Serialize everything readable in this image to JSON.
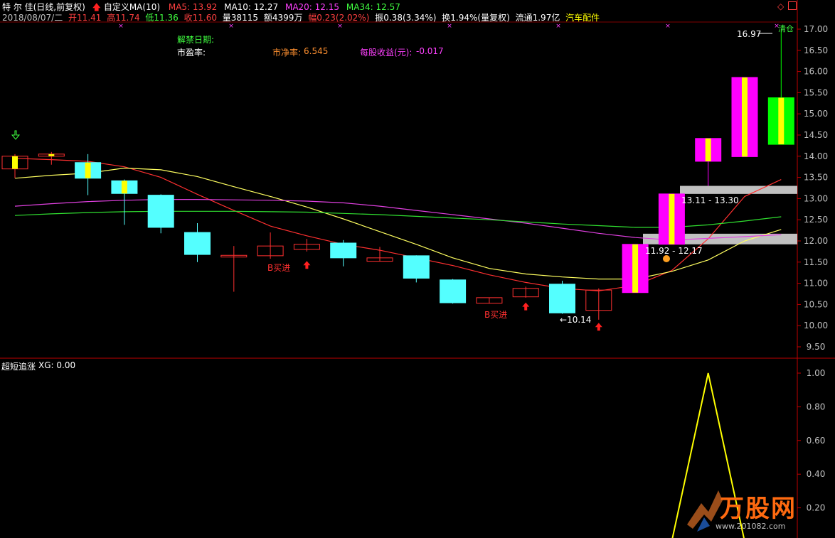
{
  "header": {
    "title": "特 尔 佳(日线,前复权)",
    "indicator": "自定义MA(10)",
    "ma": [
      {
        "label": "MA5: 13.92",
        "color": "#ff4040"
      },
      {
        "label": "MA10: 12.27",
        "color": "#ffff60"
      },
      {
        "label": "MA20: 12.15",
        "color": "#ff40ff"
      },
      {
        "label": "MA34: 12.57",
        "color": "#40ff40"
      }
    ],
    "info": [
      {
        "text": "2018/08/07/二",
        "color": "#c0c0c0"
      },
      {
        "text": "开11.41",
        "color": "#ff4040"
      },
      {
        "text": "高11.74",
        "color": "#ff4040"
      },
      {
        "text": "低11.36",
        "color": "#40ff40"
      },
      {
        "text": "收11.60",
        "color": "#ff4040"
      },
      {
        "text": "量38115",
        "color": "#ffffff"
      },
      {
        "text": "额4399万",
        "color": "#ffffff"
      },
      {
        "text": "幅0.23(2.02%)",
        "color": "#ff4040"
      },
      {
        "text": "振0.38(3.34%)",
        "color": "#ffffff"
      },
      {
        "text": "换1.94%(量复权)",
        "color": "#ffffff"
      },
      {
        "text": "流通1.97亿",
        "color": "#ffffff"
      },
      {
        "text": "汽车配件",
        "color": "#ffff00"
      }
    ]
  },
  "info_panel": {
    "unlock_label": "解禁日期:",
    "pe_label": "市盈率:",
    "pb_label": "市净率:",
    "pb_value": "6.545",
    "eps_label": "每股收益(元):",
    "eps_value": "-0.017"
  },
  "sub_panel": {
    "title": "超短追涨",
    "xg_label": "XG: 0.00"
  },
  "annotations": {
    "buy_label": "B买进",
    "low_marker": "10.14",
    "high_marker": "16.97",
    "zone_upper": "13.11 - 13.30",
    "zone_lower": "11.92 - 12.17",
    "top_right_text": "清仓"
  },
  "watermark": {
    "text": "万股网",
    "url": "www.201082.com"
  },
  "colors": {
    "bg": "#000000",
    "grid": "#800000",
    "axis": "#c00000",
    "bull_candle": "#ff3030",
    "bear_candle": "#54ffff",
    "signal_magenta": "#ff00ff",
    "signal_green": "#00ff00",
    "signal_yellow": "#ffff00",
    "zone_gray": "#c0c0c0",
    "ma_red": "#ff3030",
    "ma_yellow": "#ffff60",
    "ma_magenta": "#e040e0",
    "ma_green": "#30e030",
    "tick_text": "#c0c0c0"
  },
  "chart_data": [
    {
      "type": "candlestick",
      "ylim": [
        9.25,
        17.25
      ],
      "yticks": [
        9.5,
        10.0,
        10.5,
        11.0,
        11.5,
        12.0,
        12.5,
        13.0,
        13.5,
        14.0,
        14.5,
        15.0,
        15.5,
        16.0,
        16.5,
        17.0
      ],
      "tick_labels": [
        "9.50",
        "10.00",
        "10.50",
        "11.00",
        "11.50",
        "12.00",
        "12.50",
        "13.00",
        "13.50",
        "14.00",
        "14.50",
        "15.00",
        "15.50",
        "16.00",
        "16.50",
        "17.00"
      ],
      "candles": [
        {
          "o": 13.7,
          "h": 14.05,
          "l": 13.48,
          "c": 14.0,
          "style": "bull_signal"
        },
        {
          "o": 14.0,
          "h": 14.1,
          "l": 13.8,
          "c": 14.05,
          "style": "bull_signal"
        },
        {
          "o": 13.85,
          "h": 14.05,
          "l": 13.08,
          "c": 13.48,
          "style": "bear_signal"
        },
        {
          "o": 13.42,
          "h": 13.45,
          "l": 12.38,
          "c": 13.12,
          "style": "bear_signal"
        },
        {
          "o": 13.08,
          "h": 13.1,
          "l": 12.18,
          "c": 12.32,
          "style": "bear"
        },
        {
          "o": 12.2,
          "h": 12.42,
          "l": 11.5,
          "c": 11.68,
          "style": "bear"
        },
        {
          "o": 11.62,
          "h": 11.88,
          "l": 10.8,
          "c": 11.66,
          "style": "bull"
        },
        {
          "o": 11.65,
          "h": 12.2,
          "l": 11.58,
          "c": 11.88,
          "style": "bull"
        },
        {
          "o": 11.8,
          "h": 12.05,
          "l": 11.75,
          "c": 11.92,
          "style": "bull"
        },
        {
          "o": 11.95,
          "h": 12.02,
          "l": 11.4,
          "c": 11.6,
          "style": "bear"
        },
        {
          "o": 11.52,
          "h": 11.86,
          "l": 11.52,
          "c": 11.6,
          "style": "bull"
        },
        {
          "o": 11.65,
          "h": 11.66,
          "l": 11.02,
          "c": 11.12,
          "style": "bear"
        },
        {
          "o": 11.08,
          "h": 11.1,
          "l": 10.52,
          "c": 10.54,
          "style": "bear"
        },
        {
          "o": 10.53,
          "h": 10.66,
          "l": 10.52,
          "c": 10.66,
          "style": "bull"
        },
        {
          "o": 10.68,
          "h": 10.92,
          "l": 10.66,
          "c": 10.88,
          "style": "bull"
        },
        {
          "o": 10.98,
          "h": 11.06,
          "l": 10.28,
          "c": 10.3,
          "style": "bear"
        },
        {
          "o": 10.36,
          "h": 10.88,
          "l": 10.14,
          "c": 10.84,
          "style": "bull"
        },
        {
          "o": 10.78,
          "h": 11.92,
          "l": 10.78,
          "c": 11.92,
          "style": "limit_up"
        },
        {
          "o": 11.92,
          "h": 13.11,
          "l": 11.92,
          "c": 13.11,
          "style": "limit_up"
        },
        {
          "o": 13.88,
          "h": 14.42,
          "l": 13.3,
          "c": 14.42,
          "style": "limit_up"
        },
        {
          "o": 13.99,
          "h": 15.86,
          "l": 13.99,
          "c": 15.86,
          "style": "limit_up"
        },
        {
          "o": 15.38,
          "h": 16.97,
          "l": 14.28,
          "c": 14.28,
          "style": "limit_down"
        }
      ],
      "ma_lines": [
        {
          "color_key": "ma_red",
          "values": [
            13.95,
            13.92,
            13.88,
            13.75,
            13.5,
            13.1,
            12.72,
            12.35,
            12.12,
            11.92,
            11.78,
            11.6,
            11.42,
            11.2,
            11.02,
            10.88,
            10.82,
            10.95,
            11.3,
            12.05,
            13.05,
            13.45
          ]
        },
        {
          "color_key": "ma_yellow",
          "values": [
            13.48,
            13.55,
            13.6,
            13.72,
            13.68,
            13.52,
            13.28,
            13.05,
            12.8,
            12.52,
            12.22,
            11.92,
            11.6,
            11.35,
            11.22,
            11.15,
            11.1,
            11.1,
            11.28,
            11.55,
            12.0,
            12.27
          ]
        },
        {
          "color_key": "ma_magenta",
          "values": [
            12.82,
            12.88,
            12.93,
            12.96,
            12.98,
            12.98,
            12.97,
            12.96,
            12.94,
            12.9,
            12.82,
            12.72,
            12.62,
            12.52,
            12.42,
            12.3,
            12.18,
            12.08,
            12.02,
            12.06,
            12.1,
            12.15
          ]
        },
        {
          "color_key": "ma_green",
          "values": [
            12.6,
            12.64,
            12.67,
            12.69,
            12.7,
            12.7,
            12.7,
            12.69,
            12.68,
            12.65,
            12.62,
            12.58,
            12.54,
            12.5,
            12.45,
            12.4,
            12.36,
            12.32,
            12.32,
            12.38,
            12.47,
            12.57
          ]
        }
      ]
    },
    {
      "type": "line",
      "title": "超短追涨",
      "ylim": [
        0.0,
        1.05
      ],
      "yticks": [
        0.2,
        0.4,
        0.6,
        0.8,
        1.0
      ],
      "tick_labels": [
        "0.20",
        "0.40",
        "0.60",
        "0.80",
        "1.00"
      ],
      "series": [
        {
          "values": [
            0,
            0,
            0,
            0,
            0,
            0,
            0,
            0,
            0,
            0,
            0,
            0,
            0,
            0,
            0,
            0,
            0,
            0,
            0,
            1.0,
            0,
            0
          ]
        }
      ]
    }
  ]
}
